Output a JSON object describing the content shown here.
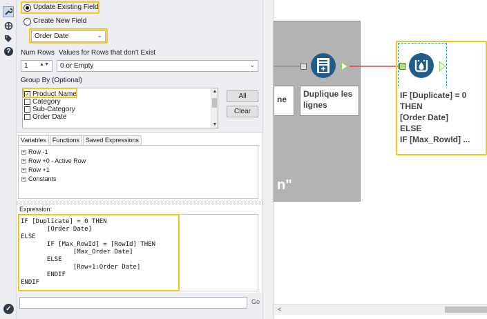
{
  "formula_config": {
    "radio_update": "Update Existing Field",
    "radio_create": "Create New  Field",
    "field_selected": "Order Date",
    "num_rows_label": "Num Rows",
    "values_label": "Values for Rows that don't Exist",
    "num_rows_value": "1",
    "values_selected": "0 or Empty",
    "group_by_label": "Group By (Optional)",
    "group_by_items": [
      "Product Name",
      "Category",
      "Sub-Category",
      "Order Date"
    ],
    "all_button": "All",
    "clear_button": "Clear"
  },
  "tabs": [
    "Variables",
    "Functions",
    "Saved Expressions"
  ],
  "variables_tree": [
    "Row -1",
    "Row +0 - Active Row",
    "Row +1",
    "Constants"
  ],
  "expression_label": "Expression:",
  "expression_code": "IF [Duplicate] = 0 THEN\n       [Order Date]\nELSE\n       IF [Max_RowId] = [RowId] THEN\n              [Max_Order Date]\n       ELSE\n              [Row+1:Order Date]\n       ENDIF\nENDIF",
  "go_label": "Go",
  "canvas": {
    "container_partial_label": "n\"",
    "left_tool_partial_label": "ne",
    "generate_rows_label": [
      "Duplique les",
      "lignes"
    ],
    "multirow_label": [
      "IF [Duplicate] = 0",
      "THEN",
      "[Order Date]",
      "ELSE",
      "IF [Max_RowId] ..."
    ]
  },
  "colors": {
    "highlight": "#f5c518",
    "tool_blue": "#1f5d8f",
    "anchor_green": "#8bd34a",
    "connection_red": "#e23a3a"
  }
}
